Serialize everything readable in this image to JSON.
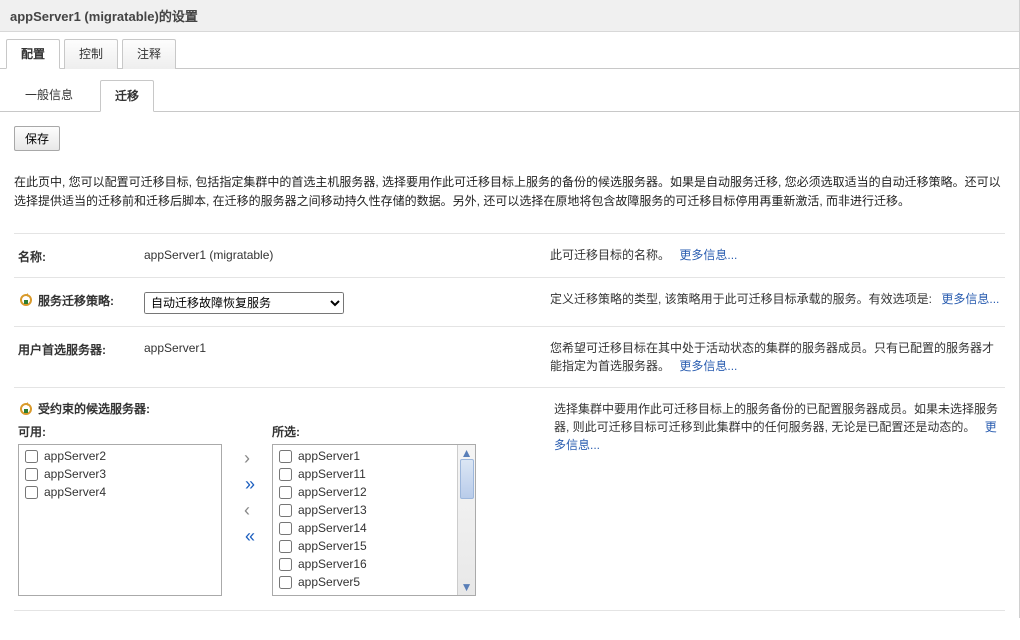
{
  "title": "appServer1 (migratable)的设置",
  "tabs": {
    "config": "配置",
    "control": "控制",
    "notes": "注释"
  },
  "subtabs": {
    "general": "一般信息",
    "migration": "迁移"
  },
  "buttons": {
    "save": "保存"
  },
  "description": "在此页中, 您可以配置可迁移目标, 包括指定集群中的首选主机服务器, 选择要用作此可迁移目标上服务的备份的候选服务器。如果是自动服务迁移, 您必须选取适当的自动迁移策略。还可以选择提供适当的迁移前和迁移后脚本, 在迁移的服务器之间移动持久性存储的数据。另外, 还可以选择在原地将包含故障服务的可迁移目标停用再重新激活, 而非进行迁移。",
  "more_info": "更多信息...",
  "rows": {
    "name": {
      "label": "名称:",
      "value": "appServer1 (migratable)",
      "help": "此可迁移目标的名称。"
    },
    "policy": {
      "label": "服务迁移策略:",
      "value": "自动迁移故障恢复服务",
      "help": "定义迁移策略的类型, 该策略用于此可迁移目标承载的服务。有效选项是:"
    },
    "preferred": {
      "label": "用户首选服务器:",
      "value": "appServer1",
      "help": "您希望可迁移目标在其中处于活动状态的集群的服务器成员。只有已配置的服务器才能指定为首选服务器。"
    }
  },
  "candidates": {
    "heading": "受约束的候选服务器:",
    "available_label": "可用:",
    "chosen_label": "所选:",
    "available": [
      "appServer2",
      "appServer3",
      "appServer4"
    ],
    "chosen": [
      "appServer1",
      "appServer11",
      "appServer12",
      "appServer13",
      "appServer14",
      "appServer15",
      "appServer16",
      "appServer5"
    ],
    "help": "选择集群中要用作此可迁移目标上的服务备份的已配置服务器成员。如果未选择服务器, 则此可迁移目标可迁移到此集群中的任何服务器, 无论是已配置还是动态的。"
  }
}
